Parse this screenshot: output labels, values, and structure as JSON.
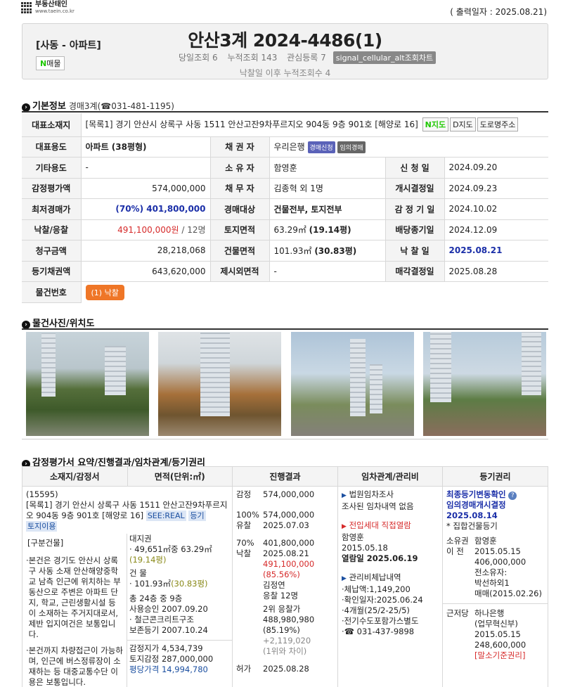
{
  "logo": {
    "text": "부동산태인",
    "url": "www.taein.co.kr"
  },
  "print_date": "( 출력일자 : 2025.08.21)",
  "header": {
    "category": "[사동 - 아파트]",
    "naver_n": "N",
    "naver_label": "매물",
    "case_number": "안산3계 2024-4486(1)",
    "views_today": "당일조회 6",
    "views_total": "누적조회 143",
    "interest": "관심등록 7",
    "chart_button": "signal_cellular_alt조회차트",
    "after_sale_views": "낙찰일 이후 누적조회수 4"
  },
  "basic_section": {
    "title": "기본정보",
    "sub": "경매3계(☎031-481-1195)"
  },
  "basic": {
    "address_label": "대표소재지",
    "address": "[목록1] 경기 안산시 상록구 사동 1511 안산고잔9차푸르지오 904동 9층 901호 [해양로 16]",
    "map_n": "N지도",
    "map_d": "D지도",
    "road_btn": "도로명주소",
    "rows": [
      {
        "l1": "대표용도",
        "v1": "아파트 (38평형)",
        "l2": "채 권 자",
        "v2": "우리은행",
        "tag1": "경매신청",
        "tag2": "임의경매"
      },
      {
        "l1": "기타용도",
        "v1": "-",
        "l2": "소 유 자",
        "v2": "함영훈",
        "l3": "신 청 일",
        "v3": "2024.09.20"
      },
      {
        "l1": "감정평가액",
        "v1": "574,000,000",
        "l2": "채 무 자",
        "v2": "김종혁 외 1명",
        "l3": "개시결정일",
        "v3": "2024.09.23"
      },
      {
        "l1": "최저경매가",
        "v1": "(70%) 401,800,000",
        "l2": "경매대상",
        "v2": "건물전부, 토지전부",
        "l3": "감 정 기 일",
        "v3": "2024.10.02"
      },
      {
        "l1": "낙찰/응찰",
        "v1a": "491,100,000원",
        "v1b": " / 12명",
        "l2": "토지면적",
        "v2a": "63.29㎡ ",
        "v2b": "(19.14평)",
        "l3": "배당종기일",
        "v3": "2024.12.09"
      },
      {
        "l1": "청구금액",
        "v1": "28,218,068",
        "l2": "건물면적",
        "v2a": "101.93㎡ ",
        "v2b": "(30.83평)",
        "l3": "낙 찰 일",
        "v3": "2025.08.21"
      },
      {
        "l1": "등기채권액",
        "v1": "643,620,000",
        "l2": "제시외면적",
        "v2": "-",
        "l3": "매각결정일",
        "v3": "2025.08.28"
      }
    ],
    "item_label": "물건번호",
    "item_btn": "(1) 낙찰"
  },
  "photo_section": {
    "title": "물건사진/위치도"
  },
  "summary_section": {
    "title": "감정평가서 요약/진행결과/임차관계/등기권리"
  },
  "summary": {
    "headers": [
      "소재지/감정서",
      "면적(단위:㎡)",
      "진행결과",
      "임차관계/관리비",
      "등기권리"
    ],
    "loc": {
      "zip": "(15595)",
      "addr": "[목록1] 경기 안산시 상록구 사동 1511 안산고잔9차푸르지오 904동 9층 901호 [해양로 16]",
      "tag1": "SEE:REAL",
      "tag2": "등기",
      "tag3": "토지이용",
      "div_title": "[구분건물]",
      "bullet1": "본건은 경기도 안산시 상록구 사동 소재 안산해양중학교 남측 인근에 위치하는 부동산으로 주변은 아파트 단지, 학교, 근린생활시설 등이 소재하는 주거지대로서, 제반 입지여건은 보통입니다.",
      "bullet2": "본건까지 차량접근이 가능하며, 인근에 버스정류장이 소재하는 등 대중교통수단 이용은 보통입니다."
    },
    "area": {
      "land_right": "대지권",
      "land_line": "· 49,651㎡중 63.29㎡",
      "land_py": "(19.14평)",
      "bldg": "건 물",
      "bldg_line": "· 101.93㎡",
      "bldg_py": "(30.83평)",
      "floors": "총 24층 중 9층",
      "approval": "사용승인 2007.09.20",
      "structure": "· 철근콘크리트구조",
      "reg": "보존등기 2007.10.24",
      "land_price_l": "감정지가",
      "land_price": "4,534,739",
      "land_appr_l": "토지감정",
      "land_appr": "287,000,000",
      "py_price_l": "평당가격",
      "py_price": "14,994,780"
    },
    "progress": {
      "appr_l": "감정",
      "appr": "574,000,000",
      "r1_l1": "100%",
      "r1_l2": "유찰",
      "r1_v1": "574,000,000",
      "r1_v2": "2025.07.03",
      "r2_l1": "70%",
      "r2_l2": "낙찰",
      "r2_v1": "401,800,000",
      "r2_v2": "2025.08.21",
      "r2_price": "491,100,000",
      "r2_pct": "(85.56%)",
      "r2_winner": "김정연",
      "r2_bidders": "응찰 12명",
      "r2_second": "2위 응찰가",
      "r2_second_v": "488,980,980",
      "r2_second_pct": "(85.19%)",
      "r2_diff": "+2,119,020",
      "r2_diff_note": "(1위와 차이)",
      "r3_l": "허가",
      "r3_v": "2025.08.28"
    },
    "tenant": {
      "court_t": "법원임차조사",
      "court_v": "조사된 임차내역 없음",
      "move_t": "전입세대 직접열람",
      "move_name": "함영훈",
      "move_date": "2015.05.18",
      "viewed": "열람일 2025.06.19",
      "fee_t": "관리비체납내역",
      "fee1": "·체납액:1,149,200",
      "fee2": "·확인일자:2025.06.24",
      "fee3": "·4개월(25/2-25/5)",
      "fee4": "·전기수도포함가스별도",
      "fee5": "·☎ 031-437-9898"
    },
    "registry": {
      "latest": "최종등기변동확인",
      "kind": "임의경매개시결정",
      "date": "2025.08.14",
      "note": "* 집합건물등기",
      "own_l1": "소유권",
      "own_l2": "이 전",
      "own_name": "함영훈",
      "own_date": "2015.05.15",
      "own_amt": "406,000,000",
      "prev_l": "전소유자:",
      "prev_name": "박선하외1",
      "prev_trade": "매매(2015.02.26)",
      "mort_l": "근저당",
      "mort_name": "하나은행",
      "mort_branch": "(업무혁신부)",
      "mort_date": "2015.05.15",
      "mort_amt": "248,600,000",
      "mort_note": "[말소기준권리]"
    }
  }
}
